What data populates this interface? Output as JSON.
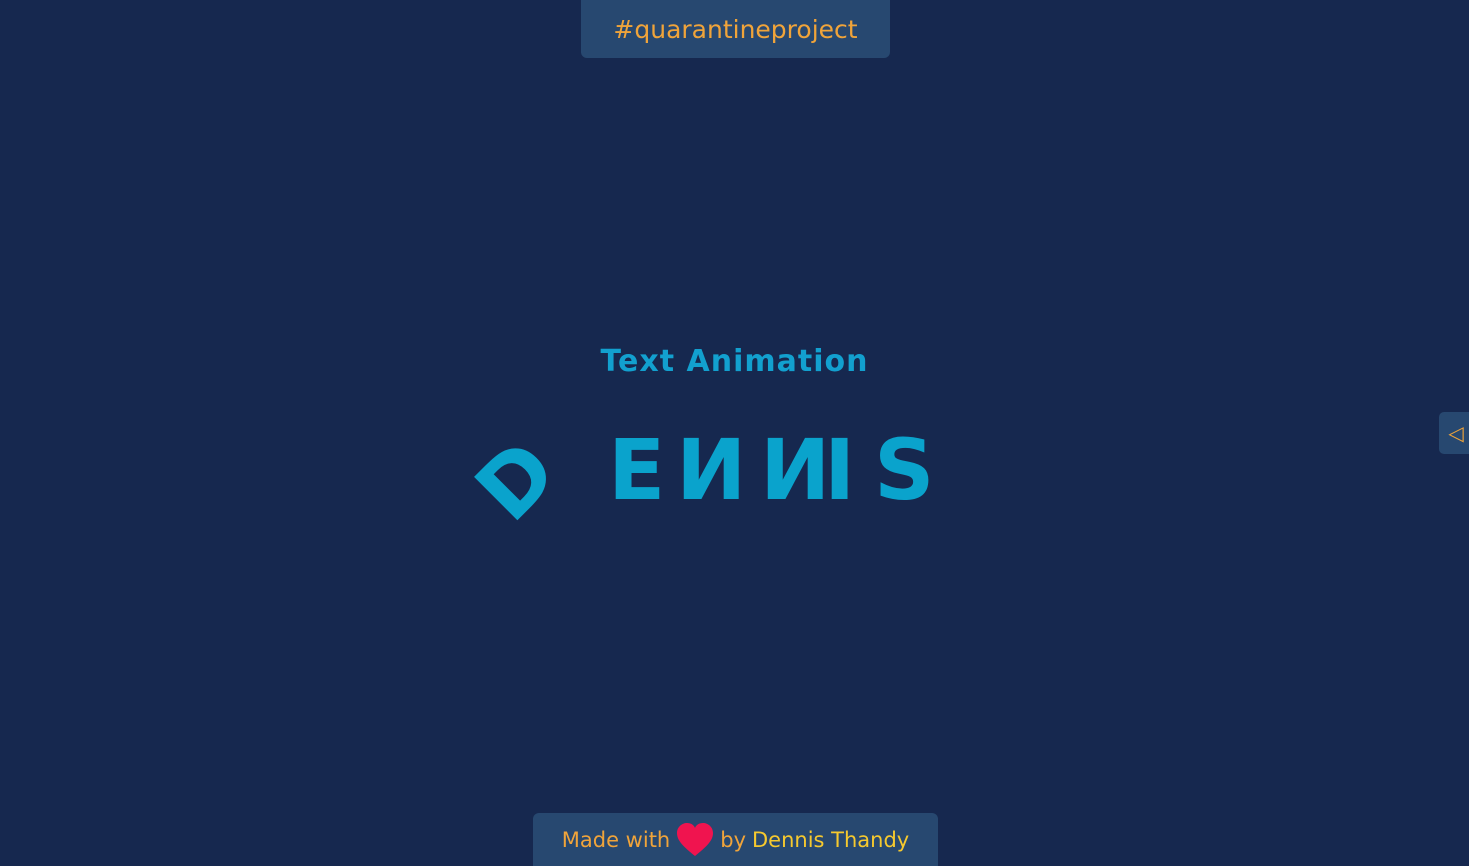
{
  "tag": {
    "text": "#quarantineproject"
  },
  "main": {
    "title": "Text Animation",
    "letters": [
      "D",
      "E",
      "N",
      "N",
      "I",
      "S"
    ]
  },
  "side_toggle": {
    "glyph": "◁",
    "icon": "triangle-left-icon"
  },
  "footer": {
    "made_with": "Made with",
    "heart_icon": "heart-icon",
    "by": "by",
    "author": "Dennis Thandy"
  },
  "colors": {
    "background": "#16284f",
    "panel": "#274870",
    "accent_orange": "#f0a43a",
    "accent_yellow": "#f6c92e",
    "text_cyan": "#0aa3cc",
    "heart_red": "#f0144f"
  }
}
